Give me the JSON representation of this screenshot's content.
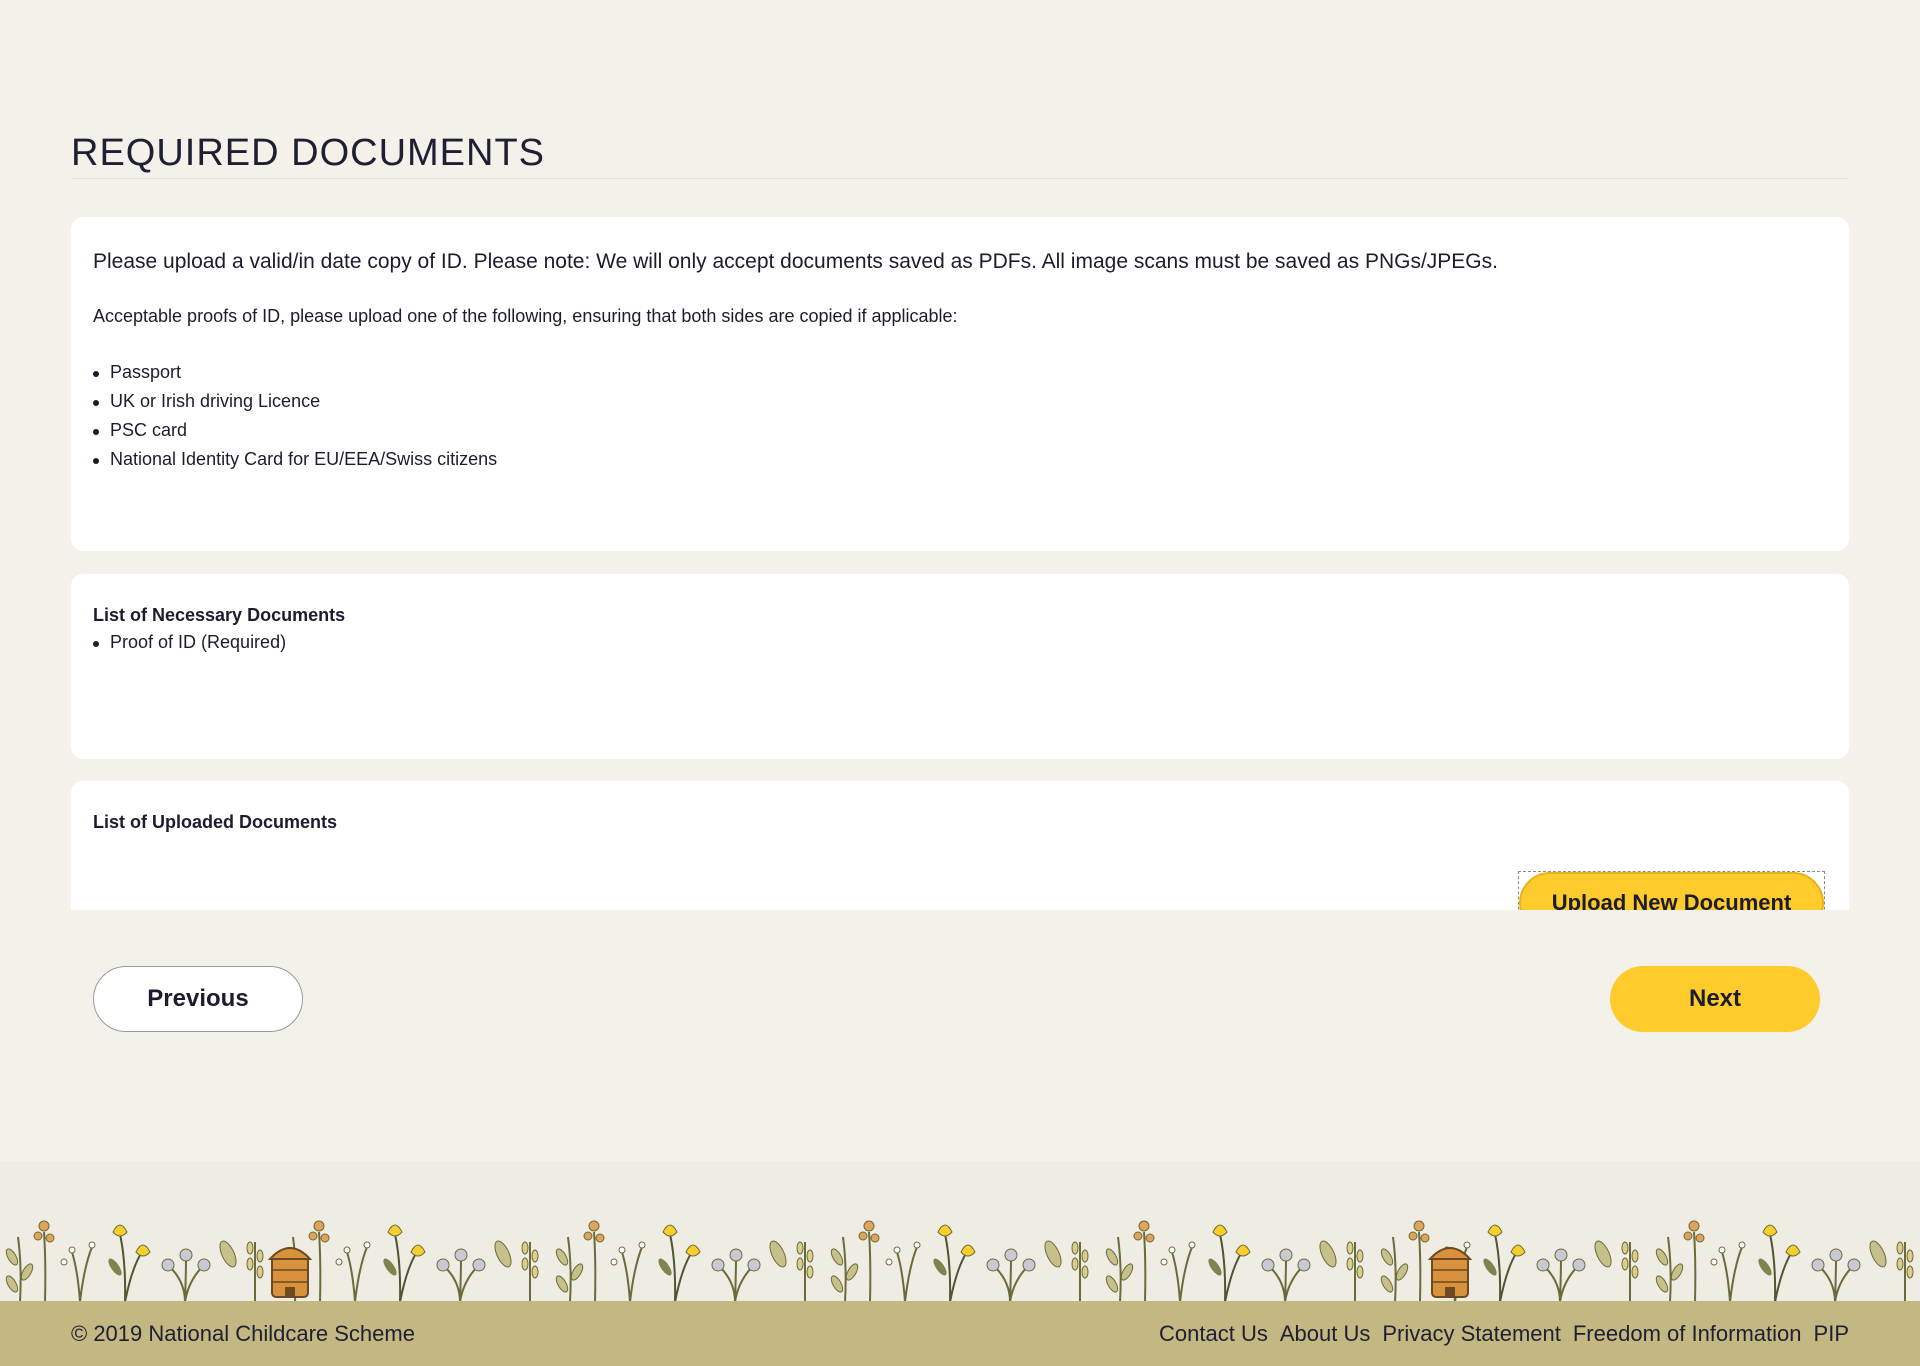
{
  "page": {
    "title": "REQUIRED DOCUMENTS"
  },
  "intro": {
    "main_text": "Please upload a valid/in date copy of ID. Please note: We will only accept documents saved as PDFs. All image scans must be saved as PNGs/JPEGs.",
    "sub_text": "Acceptable proofs of ID, please upload one of the following, ensuring that both sides are copied if applicable:",
    "id_types": [
      "Passport",
      "UK or Irish driving Licence",
      "PSC card",
      "National Identity Card for EU/EEA/Swiss citizens"
    ]
  },
  "necessary": {
    "heading": "List of Necessary Documents",
    "items": [
      "Proof of ID (Required)"
    ]
  },
  "uploaded": {
    "heading": "List of Uploaded Documents",
    "upload_button": "Upload New Document"
  },
  "nav": {
    "previous": "Previous",
    "next": "Next"
  },
  "footer": {
    "copyright": "© 2019 National Childcare Scheme",
    "links": [
      "Contact Us",
      "About Us",
      "Privacy Statement",
      "Freedom of Information",
      "PIP"
    ]
  },
  "colors": {
    "page_bg": "#f3f1e9",
    "accent_yellow": "#fdcb2b",
    "footer_bar": "#c3b882",
    "text_dark": "#1c1c2e"
  },
  "icons": {
    "footer_decoration": "floral-border-icon",
    "bullet": "bullet-dot-icon"
  }
}
